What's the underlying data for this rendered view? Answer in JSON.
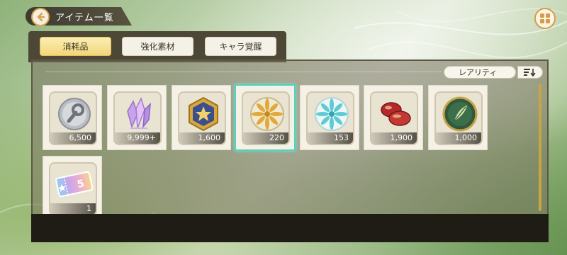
{
  "header": {
    "title": "アイテム一覧",
    "back_icon": "arrow-left-icon",
    "menu_icon": "grid-menu-icon"
  },
  "tabs": [
    {
      "label": "消耗品",
      "active": true
    },
    {
      "label": "強化素材",
      "active": false
    },
    {
      "label": "キャラ覚醒",
      "active": false
    }
  ],
  "sort": {
    "label": "レアリティ",
    "order_icon": "sort-descending-icon"
  },
  "items": [
    {
      "icon": "wrench-coin-icon",
      "count": "6,500",
      "selected": false
    },
    {
      "icon": "crystal-cluster-icon",
      "count": "9,999+",
      "selected": false
    },
    {
      "icon": "star-medal-icon",
      "count": "1,600",
      "selected": false
    },
    {
      "icon": "gold-flower-coin-icon",
      "count": "220",
      "selected": true
    },
    {
      "icon": "cyan-flower-coin-icon",
      "count": "153",
      "selected": false
    },
    {
      "icon": "red-beans-icon",
      "count": "1,900",
      "selected": false
    },
    {
      "icon": "green-leaf-coin-icon",
      "count": "1,000",
      "selected": false
    },
    {
      "icon": "rainbow-ticket-icon",
      "count": "1",
      "selected": false,
      "ticket_label": "5"
    }
  ],
  "colors": {
    "accent": "#d9a34c",
    "selected_border": "#4fd3c1",
    "tab_active": "#f2d67a"
  }
}
